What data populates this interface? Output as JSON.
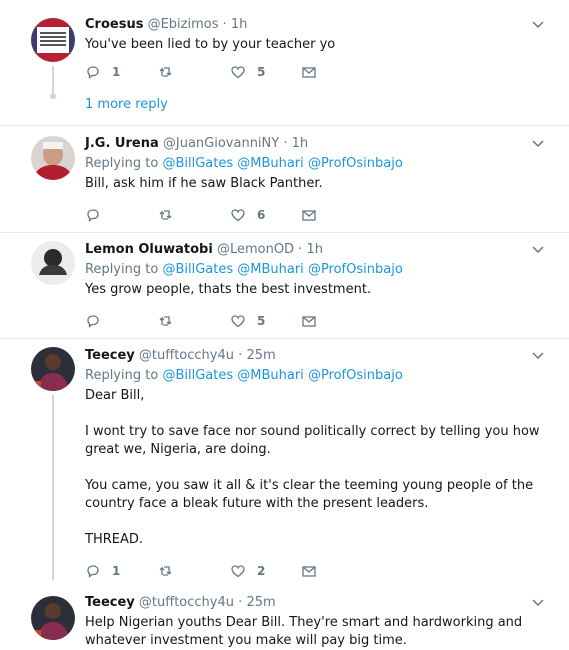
{
  "tweets": [
    {
      "name": "Croesus",
      "handle": "@Ebizimos",
      "time": "1h",
      "reply_to": null,
      "text": "You've been lied to by your teacher yo",
      "replies": "1",
      "retweets": "",
      "likes": "5"
    },
    {
      "name": "J.G. Urena",
      "handle": "@JuanGiovanniNY",
      "time": "1h",
      "reply_prefix": "Replying to",
      "reply_to": [
        "@BillGates",
        "@MBuhari",
        "@ProfOsinbajo"
      ],
      "text": "Bill, ask him if he saw Black Panther.",
      "replies": "",
      "retweets": "",
      "likes": "6"
    },
    {
      "name": "Lemon Oluwatobi",
      "handle": "@LemonOD",
      "time": "1h",
      "reply_prefix": "Replying to",
      "reply_to": [
        "@BillGates",
        "@MBuhari",
        "@ProfOsinbajo"
      ],
      "text": "Yes grow people, thats the best investment.",
      "replies": "",
      "retweets": "",
      "likes": "5"
    },
    {
      "name": "Teecey",
      "handle": "@tufftocchy4u",
      "time": "25m",
      "reply_prefix": "Replying to",
      "reply_to": [
        "@BillGates",
        "@MBuhari",
        "@ProfOsinbajo"
      ],
      "text": "Dear Bill,\n\nI wont try to save face nor sound politically correct by telling you how great we, Nigeria, are doing.\n\nYou came, you saw it all & it's clear the teeming young people of the country face a bleak future with the present leaders.\n\nTHREAD.",
      "replies": "1",
      "retweets": "",
      "likes": "2"
    },
    {
      "name": "Teecey",
      "handle": "@tufftocchy4u",
      "time": "25m",
      "reply_to": null,
      "text": "Help Nigerian youths Dear Bill. They're smart and hardworking and whatever investment you make will pay big time."
    }
  ],
  "more_replies": "1 more reply",
  "dot_separator": "·",
  "colors": {
    "link": "#1b95e0",
    "muted": "#657786",
    "thread": "#ccd6dd",
    "divider": "#e6ecf0"
  }
}
